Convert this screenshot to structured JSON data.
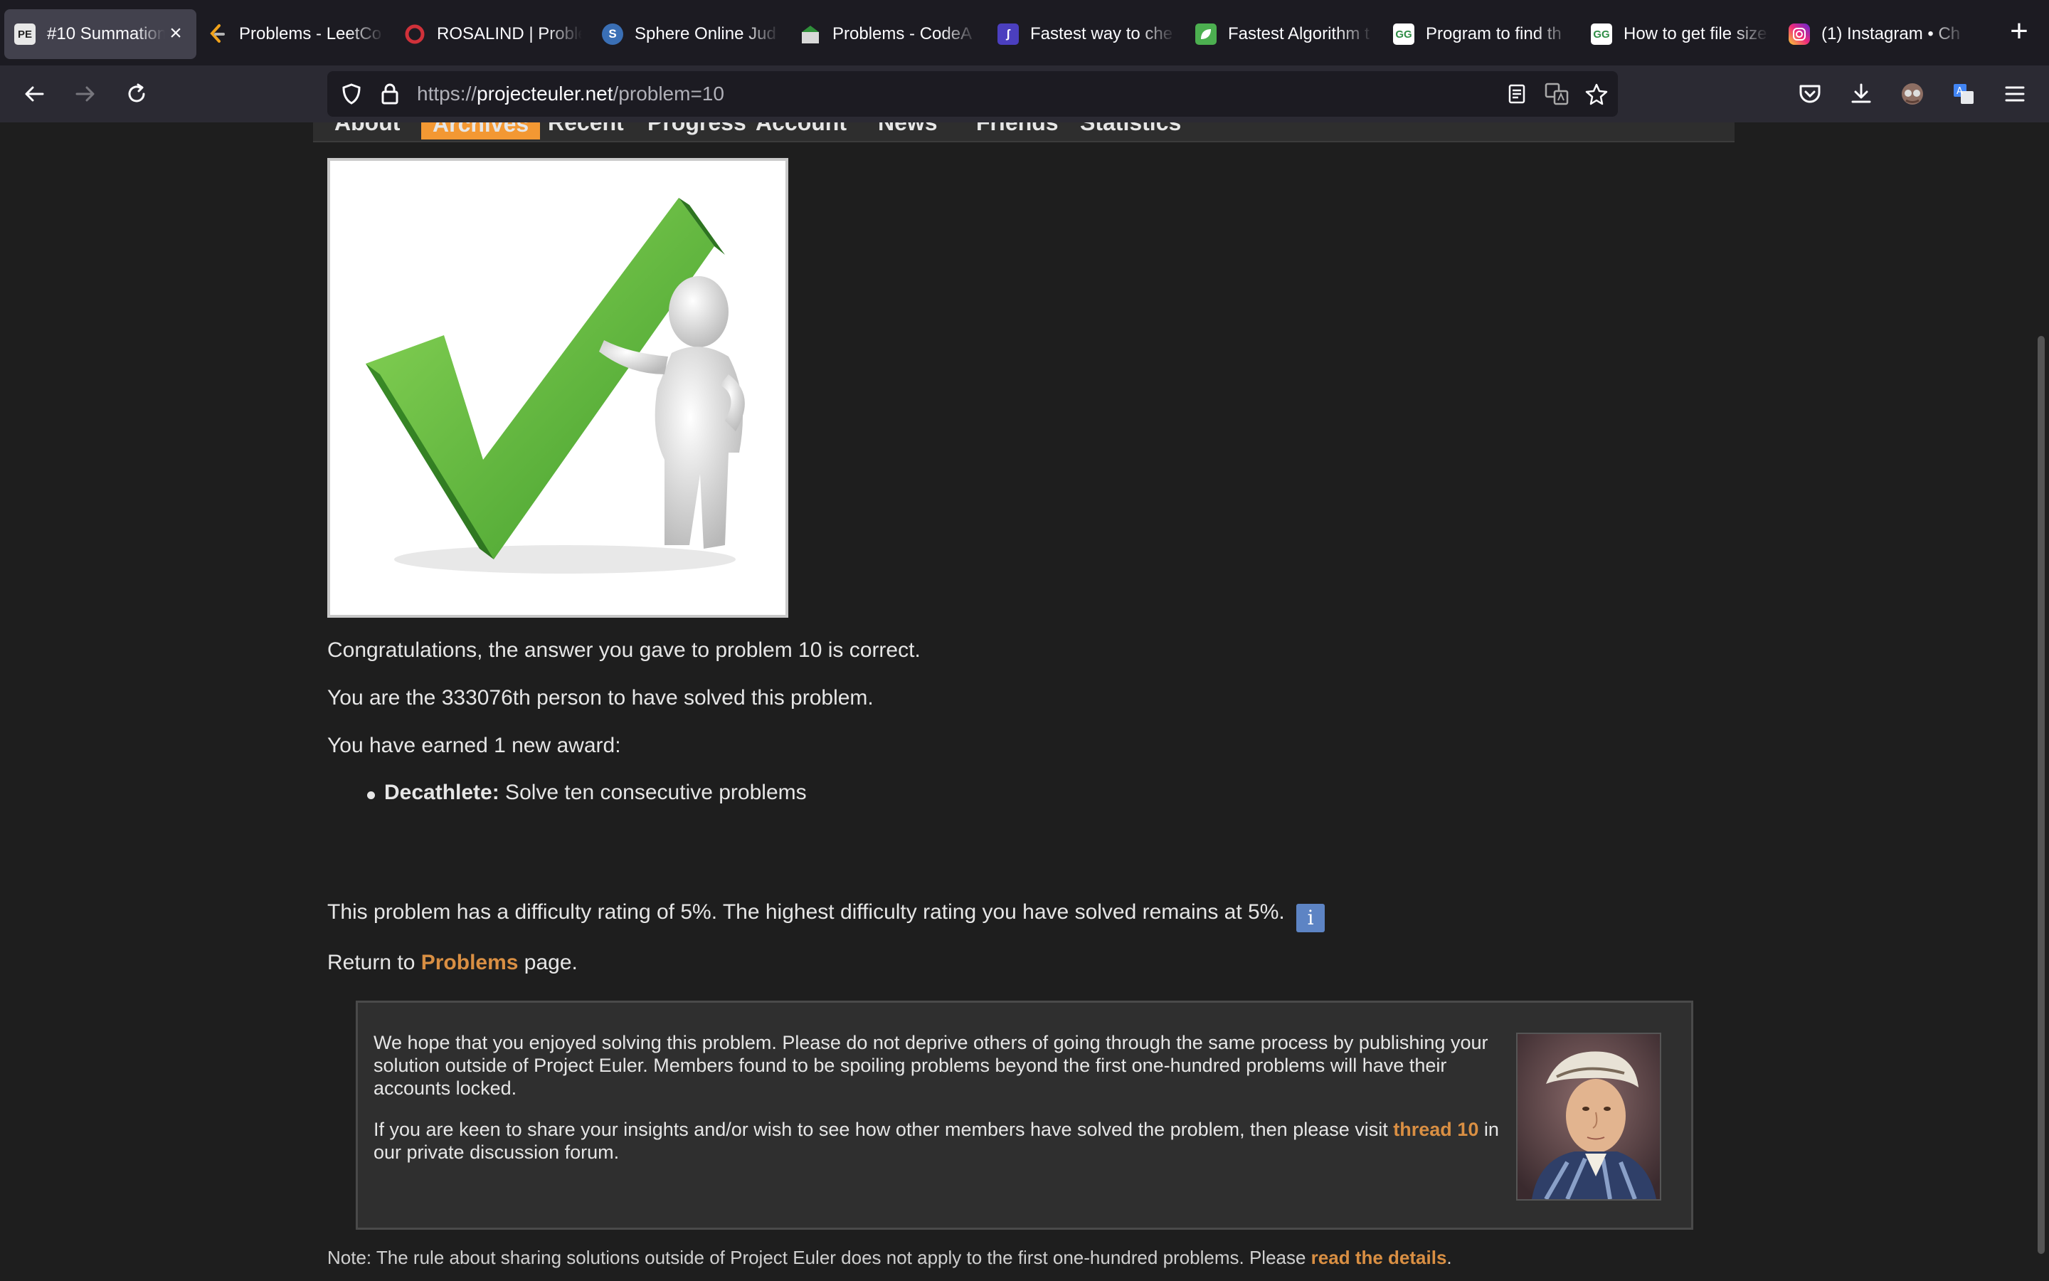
{
  "browser": {
    "tabs": [
      {
        "label": "#10 Summation",
        "icon": "project-euler-icon",
        "active": true
      },
      {
        "label": "Problems - LeetCo",
        "icon": "leetcode-icon"
      },
      {
        "label": "ROSALIND | Proble",
        "icon": "rosalind-icon"
      },
      {
        "label": "Sphere Online Jud",
        "icon": "spoj-icon"
      },
      {
        "label": "Problems - CodeA",
        "icon": "codeabbey-icon"
      },
      {
        "label": "Fastest way to che",
        "icon": "tab-icon"
      },
      {
        "label": "Fastest Algorithm t",
        "icon": "leaf-icon"
      },
      {
        "label": "Program to find th",
        "icon": "geeksforgeeks-icon"
      },
      {
        "label": "How to get file size",
        "icon": "geeksforgeeks-icon"
      },
      {
        "label": "(1) Instagram • Ch",
        "icon": "instagram-icon"
      }
    ],
    "url_prefix": "https://",
    "url_domain": "projecteuler.net",
    "url_path": "/problem=10"
  },
  "site_nav": {
    "items": [
      "About",
      "Archives",
      "Recent",
      "Progress",
      "Account",
      "News",
      "Friends",
      "Statistics"
    ],
    "active": "Archives"
  },
  "result": {
    "congrats": "Congratulations, the answer you gave to problem 10 is correct.",
    "solved_count": "You are the 333076th person to have solved this problem.",
    "earned": "You have earned 1 new award:",
    "award_name": "Decathlete:",
    "award_desc": " Solve ten consecutive problems",
    "difficulty": "This problem has a difficulty rating of 5%. The highest difficulty rating you have solved remains at 5%.",
    "info_glyph": "i",
    "return_prefix": "Return to ",
    "return_link": "Problems",
    "return_suffix": " page."
  },
  "notice": {
    "para1": "We hope that you enjoyed solving this problem. Please do not deprive others of going through the same process by publishing your solution outside of Project Euler. Members found to be spoiling problems beyond the first one-hundred problems will have their accounts locked.",
    "para2_prefix": "If you are keen to share your insights and/or wish to see how other members have solved the problem, then please visit ",
    "para2_link": "thread 10",
    "para2_suffix": " in our private discussion forum."
  },
  "footnote": {
    "prefix": "Note: The rule about sharing solutions outside of Project Euler does not apply to the first one-hundred problems. Please ",
    "link": "read the details",
    "suffix": "."
  }
}
